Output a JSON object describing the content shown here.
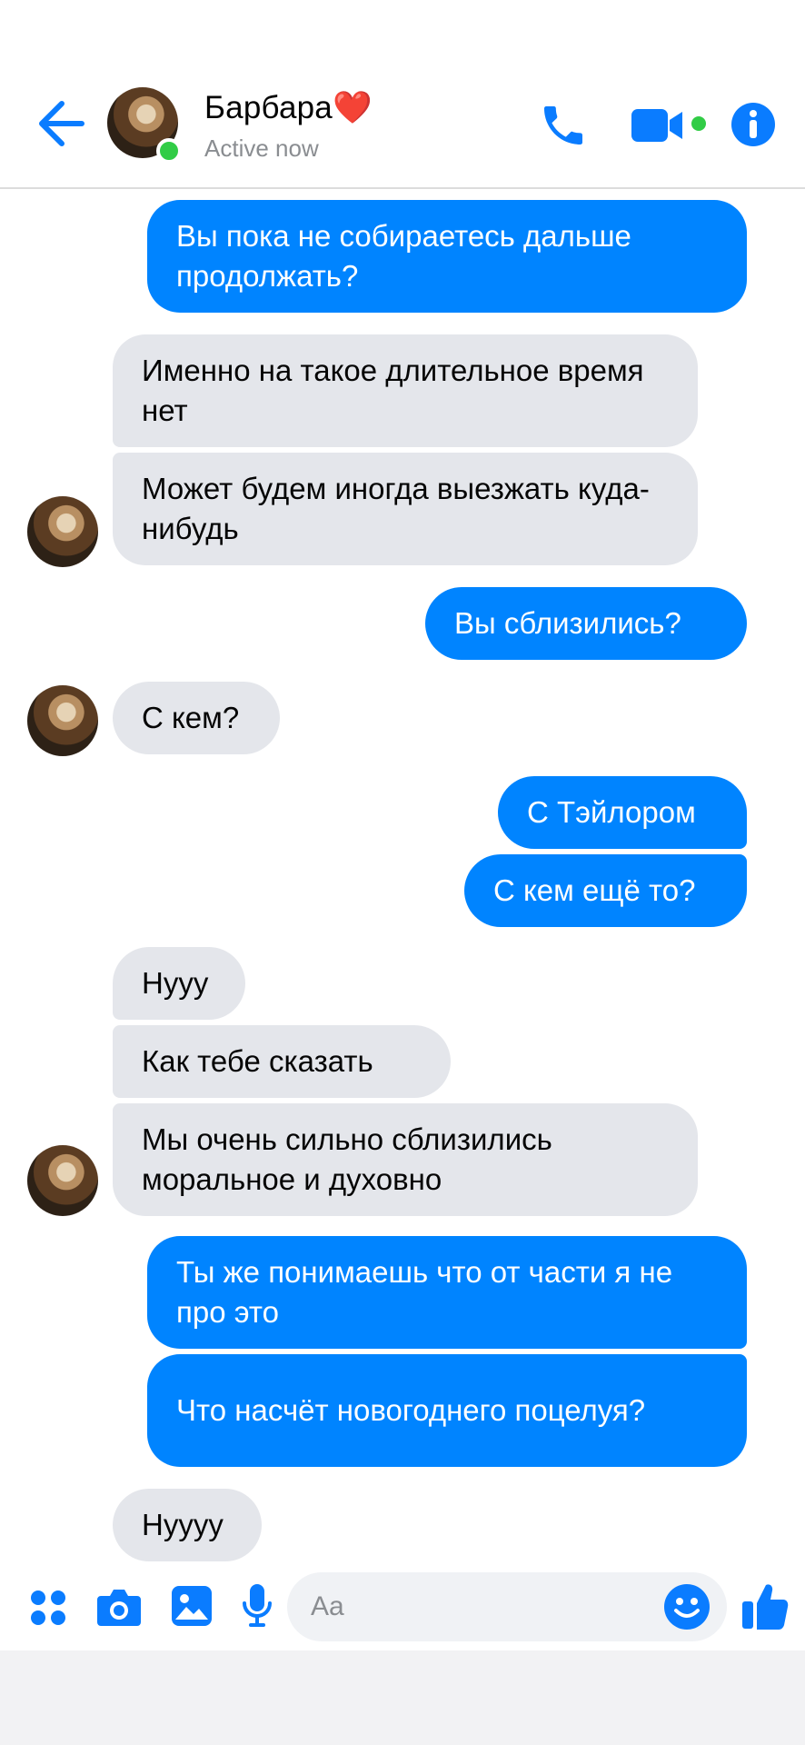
{
  "header": {
    "contact_name": "Барбара❤️",
    "status": "Active now"
  },
  "messages": [
    {
      "dir": "sent",
      "text": "Вы пока не собираетесь дальше продолжать?"
    },
    {
      "dir": "received",
      "text": "Именно на такое длительное время нет"
    },
    {
      "dir": "received",
      "text": "Может будем иногда выезжать куда-нибудь"
    },
    {
      "dir": "sent",
      "text": "Вы сблизились?"
    },
    {
      "dir": "received",
      "text": "С кем?"
    },
    {
      "dir": "sent",
      "text": "С Тэйлором"
    },
    {
      "dir": "sent",
      "text": "С кем ещё то?"
    },
    {
      "dir": "received",
      "text": "Нууу"
    },
    {
      "dir": "received",
      "text": "Как тебе сказать"
    },
    {
      "dir": "received",
      "text": "Мы очень сильно сблизились моральное и духовно"
    },
    {
      "dir": "sent",
      "text": "Ты же понимаешь что от части я не про это"
    },
    {
      "dir": "sent",
      "text": "Что насчёт новогоднего поцелуя?"
    },
    {
      "dir": "received",
      "text": "Нуууу"
    }
  ],
  "composer": {
    "placeholder": "Aa"
  },
  "colors": {
    "accent": "#0084ff",
    "received_bubble": "#e4e6eb",
    "online": "#31cc46"
  },
  "icons": [
    "back-arrow-icon",
    "phone-icon",
    "video-camera-icon",
    "info-icon",
    "apps-grid-icon",
    "camera-icon",
    "image-icon",
    "microphone-icon",
    "emoji-icon",
    "thumbs-up-icon"
  ]
}
